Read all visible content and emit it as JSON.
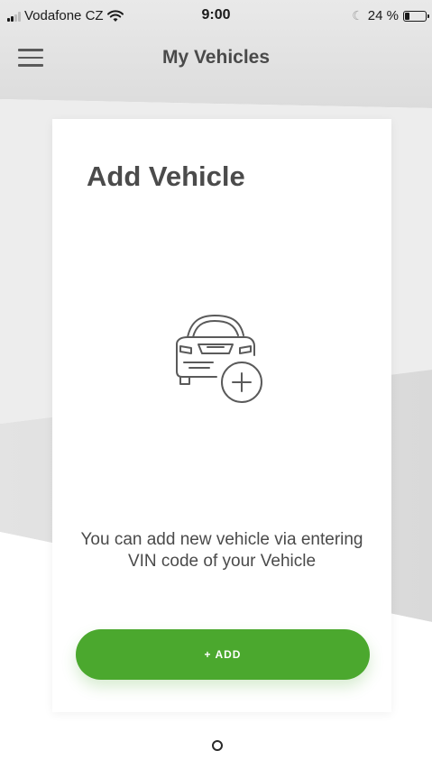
{
  "status_bar": {
    "carrier": "Vodafone CZ",
    "time": "9:00",
    "battery_label": "24 %",
    "battery_level": 0.24,
    "icons": [
      "signal-icon",
      "wifi-icon",
      "moon-icon",
      "battery-icon"
    ]
  },
  "header": {
    "title": "My Vehicles",
    "menu_icon": "hamburger-menu-icon"
  },
  "card": {
    "title": "Add Vehicle",
    "illustration_icon": "car-add-icon",
    "message": "You can add new vehicle via entering VIN code of your Vehicle",
    "add_button_label": "+ ADD"
  },
  "colors": {
    "accent_green": "#4ba82e",
    "text_dark": "#4a4a4a",
    "background_gray": "#e4e4e4"
  },
  "pager": {
    "current_page": 1,
    "total_pages": 1
  }
}
